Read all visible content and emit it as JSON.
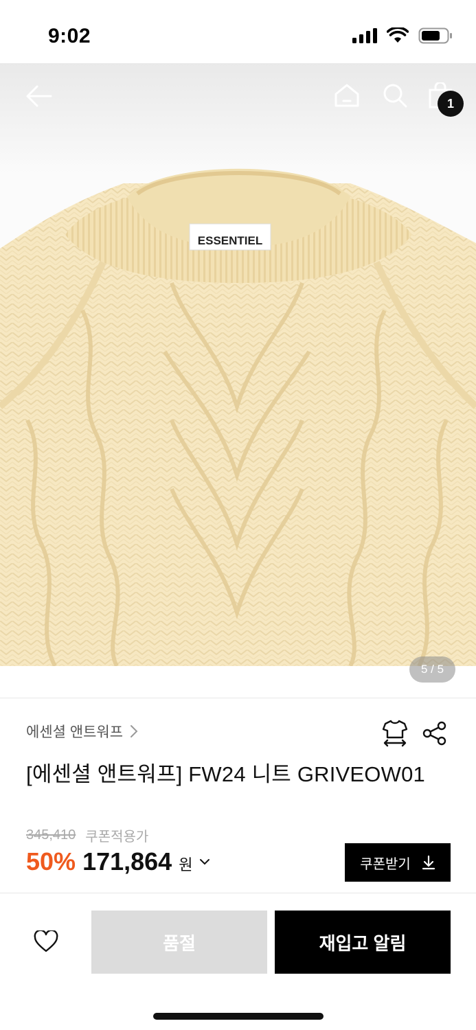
{
  "status_bar": {
    "time": "9:02",
    "icons": [
      "signal-icon",
      "wifi-icon",
      "battery-icon"
    ]
  },
  "top_nav": {
    "icons": [
      "back-arrow-icon",
      "home-icon",
      "search-icon",
      "shopping-bag-icon"
    ],
    "cart_count": "1"
  },
  "gallery": {
    "label_text": "ESSENTIEL",
    "counter": "5 / 5"
  },
  "product": {
    "brand": "에센셜 앤트워프",
    "title": "[에센셜 앤트워프] FW24 니트 GRIVEOW01",
    "icons": [
      "size-guide-shirt-icon",
      "share-icon"
    ]
  },
  "price": {
    "original": "345,410",
    "coupon_note": "쿠폰적용가",
    "discount": "50%",
    "final": "171,864",
    "currency": "원"
  },
  "coupon_button": {
    "label": "쿠폰받기"
  },
  "bottom_bar": {
    "soldout_label": "품절",
    "restock_label": "재입고 알림"
  },
  "colors": {
    "accent_discount": "#ef5a1e",
    "sweater": "#f7e9c3",
    "black": "#000000"
  }
}
